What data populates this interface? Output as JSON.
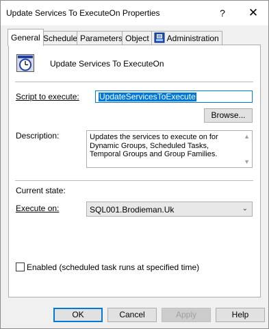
{
  "window": {
    "title": "Update Services To ExecuteOn Properties",
    "help_glyph": "?",
    "close_glyph": "✕"
  },
  "tabs": [
    {
      "label": "General",
      "active": true
    },
    {
      "label": "Schedule",
      "active": false
    },
    {
      "label": "Parameters",
      "active": false
    },
    {
      "label": "Object",
      "active": false
    },
    {
      "label": "Administration",
      "active": false,
      "icon": "shield-icon"
    }
  ],
  "general": {
    "object_icon": "clock-icon",
    "object_name": "Update Services To ExecuteOn",
    "script_label": "Script to execute:",
    "script_value": "UpdateServicesToExecute",
    "browse_label": "Browse...",
    "description_label": "Description:",
    "description_text": "Updates the services to execute on for Dynamic Groups, Scheduled Tasks, Temporal Groups and Group Families.",
    "current_state_label": "Current state:",
    "execute_on_label": "Execute on:",
    "execute_on_value": "SQL001.Brodieman.Uk",
    "enabled_label": "Enabled (scheduled task runs at specified time)",
    "enabled_checked": false
  },
  "footer": {
    "ok_label": "OK",
    "cancel_label": "Cancel",
    "apply_label": "Apply",
    "help_label": "Help"
  },
  "colors": {
    "accent": "#0078d7",
    "window_bg": "#f0f0f0",
    "panel_bg": "#ffffff"
  }
}
